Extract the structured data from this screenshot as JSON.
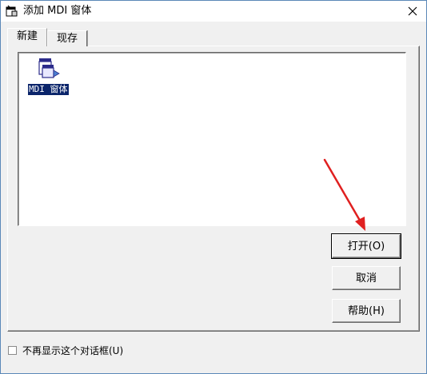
{
  "window": {
    "title": "添加 MDI 窗体"
  },
  "tabs": [
    {
      "label": "新建",
      "selected": true
    },
    {
      "label": "现存",
      "selected": false
    }
  ],
  "list": {
    "items": [
      {
        "label": "MDI 窗体",
        "icon": "mdi-form-icon",
        "selected": true
      }
    ]
  },
  "buttons": {
    "open": "打开(O)",
    "cancel": "取消",
    "help": "帮助(H)"
  },
  "checkbox": {
    "label": "不再显示这个对话框(U)",
    "checked": false
  },
  "annotation": {
    "arrow_color": "#e02020"
  },
  "colors": {
    "selection": "#0a246a",
    "window_border": "#5b88b8"
  }
}
